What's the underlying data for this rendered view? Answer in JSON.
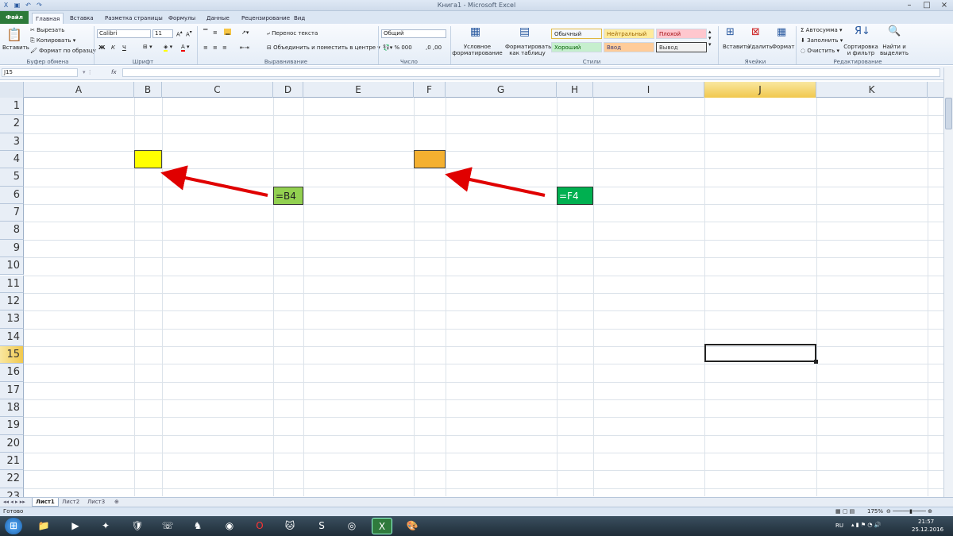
{
  "window": {
    "title": "Книга1  -  Microsoft Excel"
  },
  "tabs": [
    {
      "label": "Файл"
    },
    {
      "label": "Главная"
    },
    {
      "label": "Вставка"
    },
    {
      "label": "Разметка страницы"
    },
    {
      "label": "Формулы"
    },
    {
      "label": "Данные"
    },
    {
      "label": "Рецензирование"
    },
    {
      "label": "Вид"
    }
  ],
  "ribbon": {
    "clipboard": {
      "paste": "Вставить",
      "cut": "Вырезать",
      "copy": "Копировать",
      "format_painter": "Формат по образцу",
      "group": "Буфер обмена"
    },
    "font": {
      "name": "Calibri",
      "size": "11",
      "bold": "Ж",
      "italic": "К",
      "underline": "Ч",
      "group": "Шрифт"
    },
    "alignment": {
      "wrap": "Перенос текста",
      "merge": "Объединить и поместить в центре",
      "group": "Выравнивание"
    },
    "number": {
      "format": "Общий",
      "group": "Число"
    },
    "styles": {
      "conditional": "Условное форматирование",
      "as_table": "Форматировать как таблицу",
      "items": [
        {
          "label": "Обычный",
          "bg": "#ffffff",
          "fg": "#222222"
        },
        {
          "label": "Нейтральный",
          "bg": "#ffeb9c",
          "fg": "#9c6500"
        },
        {
          "label": "Плохой",
          "bg": "#ffc7ce",
          "fg": "#9c0006"
        },
        {
          "label": "Хороший",
          "bg": "#c6efce",
          "fg": "#006100"
        },
        {
          "label": "Ввод",
          "bg": "#ffcc99",
          "fg": "#3f3f76"
        },
        {
          "label": "Вывод",
          "bg": "#f2f2f2",
          "fg": "#3f3f3f"
        }
      ],
      "group": "Стили"
    },
    "cells": {
      "insert": "Вставить",
      "delete": "Удалить",
      "format": "Формат",
      "group": "Ячейки"
    },
    "editing": {
      "autosum": "Автосумма",
      "fill": "Заполнить",
      "clear": "Очистить",
      "sort": "Сортировка и фильтр",
      "find": "Найти и выделить",
      "group": "Редактирование"
    }
  },
  "formula_bar": {
    "name_box": "J15",
    "fx": "fx",
    "formula": ""
  },
  "grid": {
    "columns": [
      "A",
      "B",
      "C",
      "D",
      "E",
      "F",
      "G",
      "H",
      "I",
      "J",
      "K"
    ],
    "rows": [
      "1",
      "2",
      "3",
      "4",
      "5",
      "6",
      "7",
      "8",
      "9",
      "10",
      "11",
      "12",
      "13",
      "14",
      "15",
      "16",
      "17",
      "18",
      "19",
      "20",
      "21",
      "22",
      "23"
    ],
    "selected_cell": "J15"
  },
  "cells": {
    "B4": {
      "fill": "#ffff00"
    },
    "F4": {
      "fill": "#f4b030"
    },
    "D6": {
      "text": "=B4",
      "fill": "#92d050"
    },
    "H6": {
      "text": "=F4",
      "fill": "#00b050"
    }
  },
  "annotation_color": "#e00000",
  "sheets": [
    {
      "label": "Лист1",
      "active": true
    },
    {
      "label": "Лист2"
    },
    {
      "label": "Лист3"
    }
  ],
  "status": {
    "ready": "Готово",
    "zoom": "175%"
  },
  "taskbar": {
    "lang": "RU",
    "time": "21:57",
    "date": "25.12.2016"
  }
}
